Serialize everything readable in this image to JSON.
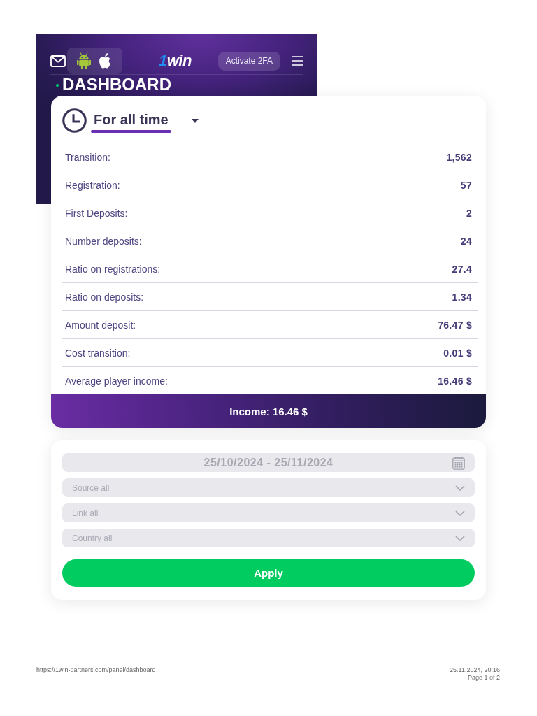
{
  "header": {
    "logo": "1win",
    "action_button": "Activate 2FA",
    "title": "DASHBOARD"
  },
  "stats_card": {
    "period": {
      "label": "For all time"
    },
    "rows": [
      {
        "label": "Transition:",
        "value": "1,562"
      },
      {
        "label": "Registration:",
        "value": "57"
      },
      {
        "label": "First Deposits:",
        "value": "2"
      },
      {
        "label": "Number deposits:",
        "value": "24"
      },
      {
        "label": "Ratio on registrations:",
        "value": "27.4"
      },
      {
        "label": "Ratio on deposits:",
        "value": "1.34"
      },
      {
        "label": "Amount deposit:",
        "value": "76.47 $"
      },
      {
        "label": "Cost transition:",
        "value": "0.01 $"
      },
      {
        "label": "Average player income:",
        "value": "16.46 $"
      }
    ],
    "income": "Income: 16.46 $"
  },
  "filters": {
    "date_range": {
      "value": "25/10/2024 - 25/11/2024"
    },
    "selects": [
      {
        "placeholder": "Source all"
      },
      {
        "placeholder": "Link all"
      },
      {
        "placeholder": "Country all"
      }
    ],
    "apply_button": "Apply"
  },
  "footer": {
    "url": "https://1win-partners.com/panel/dashboard",
    "timestamp": "25.11.2024, 20:16",
    "page": "Page 1 of 2"
  }
}
